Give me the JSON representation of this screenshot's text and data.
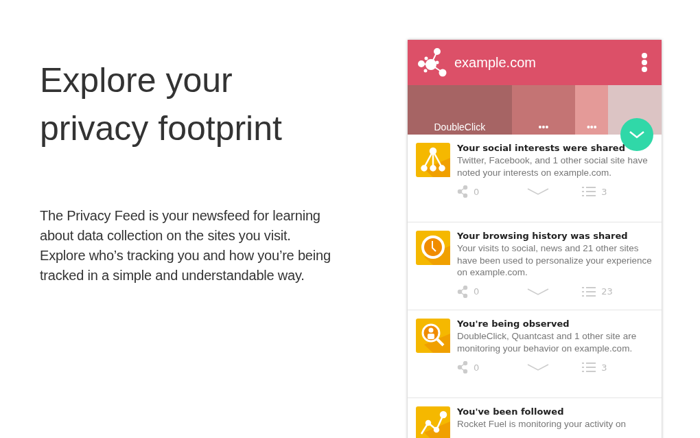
{
  "intro": {
    "heading": "Explore your privacy footprint",
    "body": "The Privacy Feed is your newsfeed for learning about data collection on the sites you visit. Explore who’s tracking you and how you’re being tracked in a simple and understandable way."
  },
  "popup": {
    "site": "example.com",
    "trackers": [
      {
        "label": "DoubleClick",
        "color": "#a66464"
      },
      {
        "label": "•••",
        "color": "#c47474"
      },
      {
        "label": "•••",
        "color": "#e49a98"
      },
      {
        "color": "#dcc4c4"
      }
    ],
    "feed": [
      {
        "kind": "network",
        "title": "Your social interests were shared",
        "text": "Twitter, Facebook, and 1 other social site have noted your interests on example.com.",
        "shares": "0",
        "items": "3"
      },
      {
        "kind": "clock",
        "title": "Your browsing history was shared",
        "text": "Your visits to social, news and 21 other sites have been used to personalize your experience on example.com.",
        "shares": "0",
        "items": "23"
      },
      {
        "kind": "observe",
        "title": "You're being observed",
        "text": "DoubleClick, Quantcast and 1 other site are monitoring your behavior on example.com.",
        "shares": "0",
        "items": "3"
      },
      {
        "kind": "chart",
        "title": "You've been followed",
        "text": "Rocket Fuel is monitoring your activity on"
      }
    ]
  }
}
